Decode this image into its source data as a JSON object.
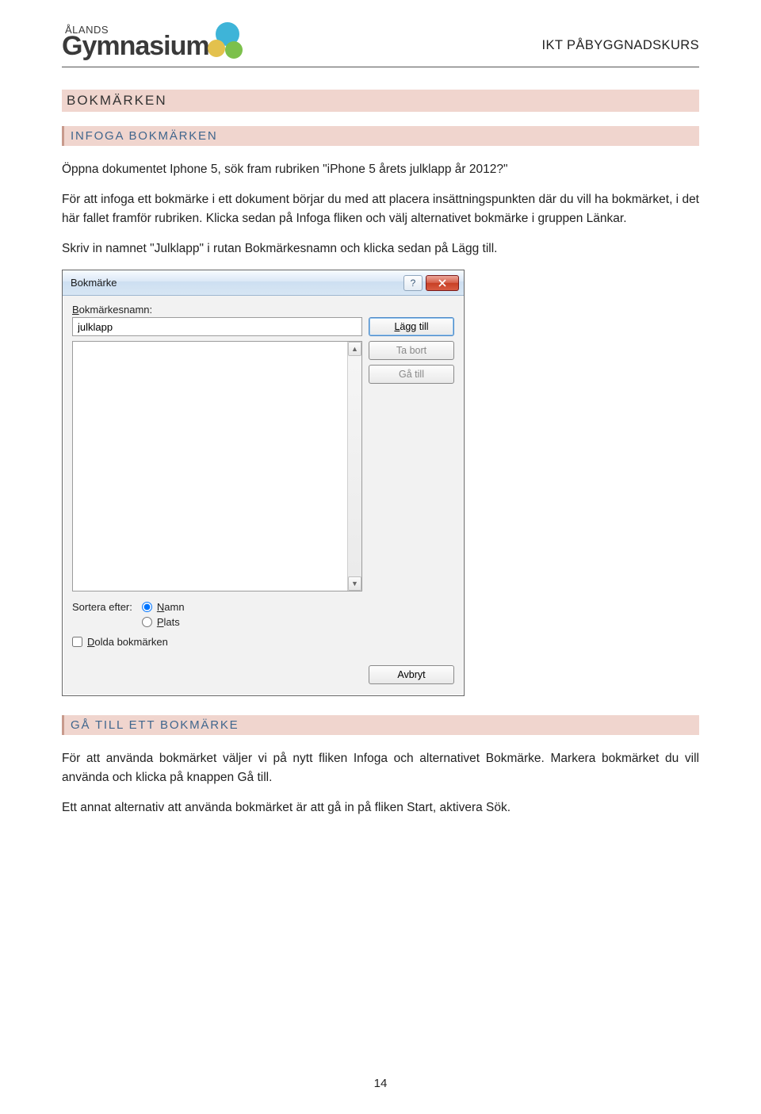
{
  "header": {
    "logo_line1": "ÅLANDS",
    "logo_line2": "Gymnasium",
    "course": "IKT PÅBYGGNADSKURS"
  },
  "sections": {
    "h1": "BOKMÄRKEN",
    "h2a": "INFOGA BOKMÄRKEN",
    "p1": "Öppna dokumentet Iphone 5, sök fram rubriken \"iPhone 5 årets julklapp år 2012?\"",
    "p2": "För att infoga ett bokmärke i ett dokument börjar du med att placera insättningspunkten där du vill ha bokmärket, i det här fallet framför rubriken. Klicka sedan på Infoga fliken och välj alternativet bokmärke i gruppen Länkar.",
    "p3": "Skriv in namnet \"Julklapp\" i rutan Bokmärkesnamn och klicka sedan på Lägg till.",
    "h2b": "GÅ TILL ETT BOKMÄRKE",
    "p4": "För att använda bokmärket väljer vi på nytt fliken Infoga och alternativet Bokmärke. Markera bokmärket du vill använda och klicka på knappen Gå till.",
    "p5": "Ett annat alternativ att använda bokmärket är att gå in på fliken Start, aktivera Sök."
  },
  "dialog": {
    "title": "Bokmärke",
    "name_label": "Bokmärkesnamn:",
    "name_value": "julklapp",
    "btn_add": "Lägg till",
    "btn_del": "Ta bort",
    "btn_goto": "Gå till",
    "sort_label": "Sortera efter:",
    "sort_name": "Namn",
    "sort_place": "Plats",
    "chk_hidden": "Dolda bokmärken",
    "help": "?",
    "cancel": "Avbryt"
  },
  "page_number": "14"
}
